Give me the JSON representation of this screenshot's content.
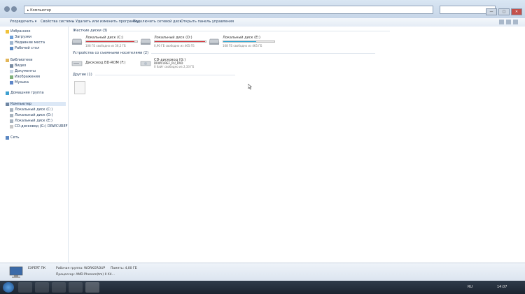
{
  "window": {
    "path": "▸ Компьютер",
    "search_placeholder": ""
  },
  "window_buttons": [
    "—",
    "□",
    "✕"
  ],
  "toolbar": {
    "items": [
      "Упорядочить ▾",
      "Свойства системы",
      "Удалить или изменить программу",
      "Подключить сетевой диск",
      "Открыть панель управления"
    ]
  },
  "sidebar": {
    "favorites": "Избранное",
    "downloads": "Загрузки",
    "recent": "Недавние места",
    "desktop": "Рабочий стол",
    "libraries": "Библиотеки",
    "video": "Видео",
    "documents": "Документы",
    "images": "Изображения",
    "music": "Музыка",
    "homegroup": "Домашняя группа",
    "computer": "Компьютер",
    "disk_c": "Локальный диск (C:)",
    "disk_d": "Локальный диск (D:)",
    "disk_e": "Локальный диск (E:)",
    "cd": "CD-дисковод (G:) DRWCUREF",
    "network": "Сеть"
  },
  "content": {
    "group_hdd": "Жесткие диски (3)",
    "group_removable": "Устройства со съемными носителями (2)",
    "group_other": "Другие (1)",
    "drives": [
      {
        "label": "Локальный диск (C:)",
        "free": "108 ГБ свободно из 56,2 ГБ",
        "fill": 0.95,
        "color": "#d9363e"
      },
      {
        "label": "Локальный диск (D:)",
        "free": "0,90 ГБ свободно из 465 ГБ",
        "fill": 0.98,
        "color": "#d9363e"
      },
      {
        "label": "Локальный диск (E:)",
        "free": "168 ГБ свободно из 465 ГБ",
        "fill": 0.65,
        "color": "#29a8d6"
      }
    ],
    "removable": [
      {
        "label": "Дисковод BD-ROM (F:)",
        "sub": ""
      },
      {
        "label": "CD-дисковод (G:)",
        "sub": "DRWCUREF_RU_DVD",
        "free": "0 байт свободно из 2,33 ГБ"
      }
    ]
  },
  "details": {
    "name": "EXPERT ПК",
    "workgroup": "Рабочая группа: WORKGROUP",
    "memory": "Память: 4,00 ГБ",
    "processor": "Процессор: AMD Phenom(tm) II X4..."
  },
  "status": "",
  "tray": {
    "lang": "RU",
    "time": "14:07"
  }
}
